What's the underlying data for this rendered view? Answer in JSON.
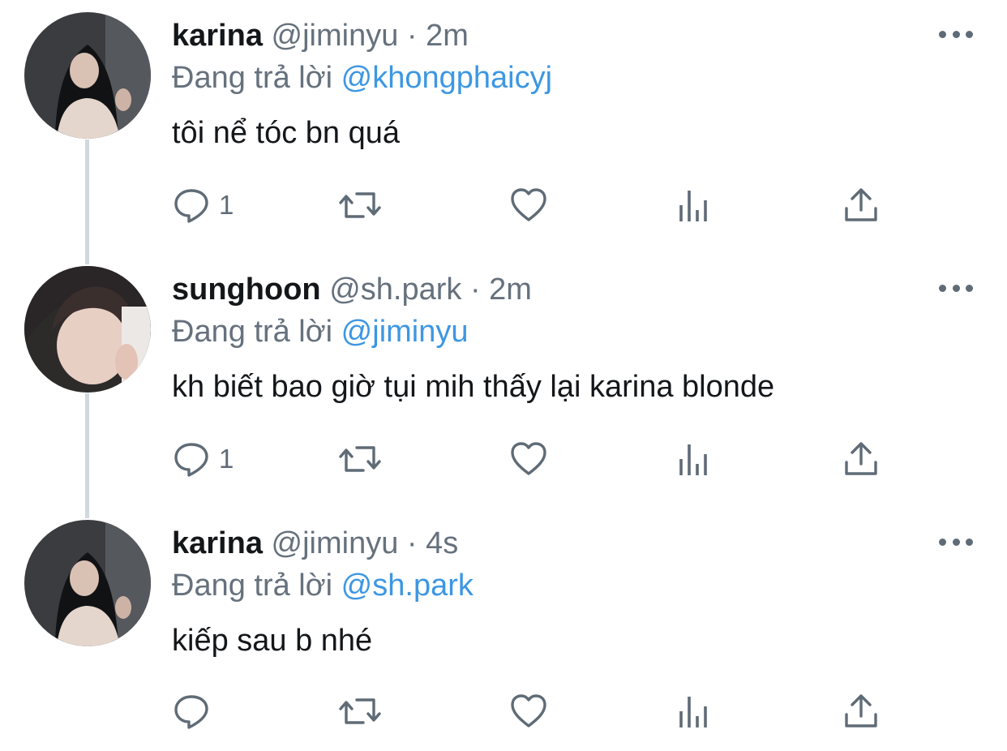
{
  "tweets": [
    {
      "name": "karina",
      "handle": "@jiminyu",
      "separator": "·",
      "time": "2m",
      "reply_prefix": "Đang trả lời",
      "reply_to": "@khongphaicyj",
      "text": "tôi nể tóc bn quá",
      "reply_count": "1",
      "avatar_icon": "profile-photo-karina"
    },
    {
      "name": "sunghoon",
      "handle": "@sh.park",
      "separator": "·",
      "time": "2m",
      "reply_prefix": "Đang trả lời",
      "reply_to": "@jiminyu",
      "text": "kh biết bao giờ tụi mih thấy lại karina blonde",
      "reply_count": "1",
      "avatar_icon": "profile-photo-sunghoon"
    },
    {
      "name": "karina",
      "handle": "@jiminyu",
      "separator": "·",
      "time": "4s",
      "reply_prefix": "Đang trả lời",
      "reply_to": "@sh.park",
      "text": "kiếp sau b nhé",
      "reply_count": "",
      "avatar_icon": "profile-photo-karina"
    }
  ],
  "icons": {
    "more": "more-dots-icon",
    "reply": "reply-bubble-icon",
    "retweet": "retweet-icon",
    "like": "heart-icon",
    "analytics": "analytics-bars-icon",
    "share": "share-upload-icon"
  },
  "colors": {
    "text": "#14171a",
    "secondary": "#66717d",
    "link": "#3d97e2",
    "thread_line": "#cfd9de",
    "icon": "#5f6b76"
  }
}
